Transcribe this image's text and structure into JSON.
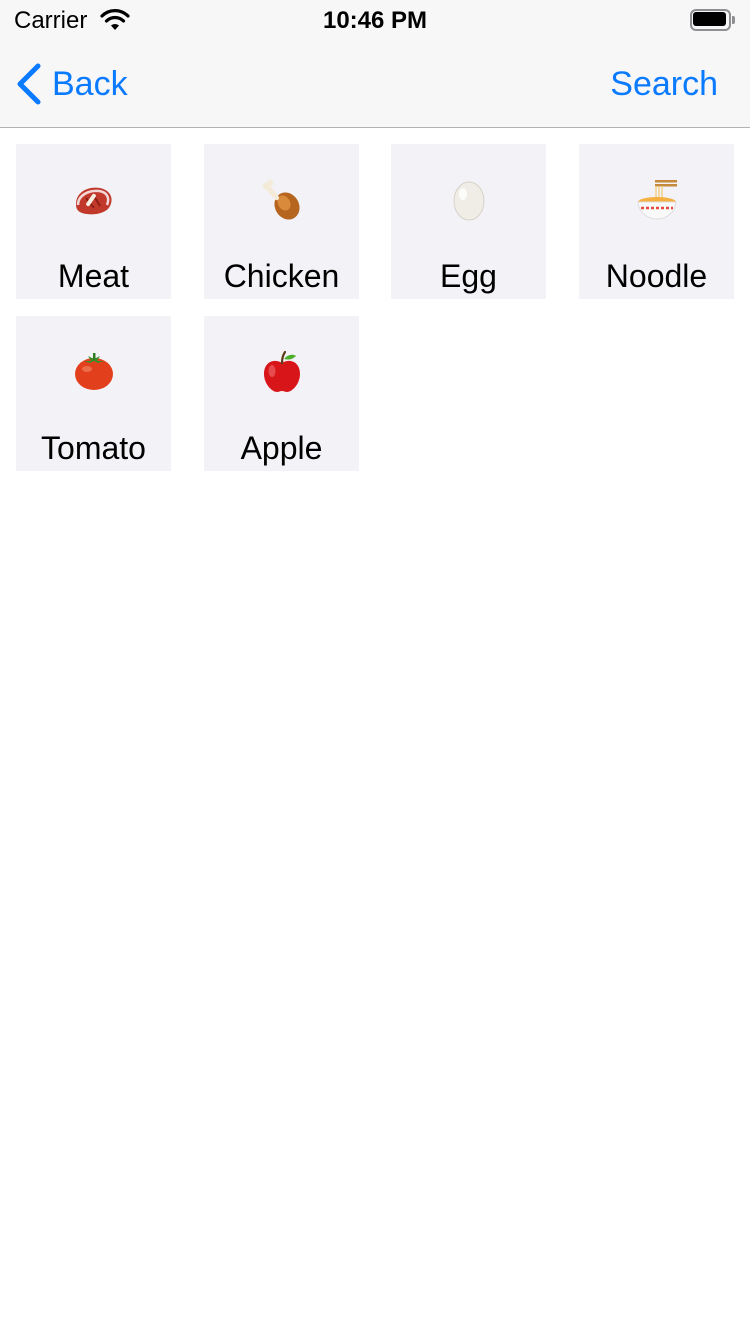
{
  "status_bar": {
    "carrier": "Carrier",
    "time": "10:46 PM"
  },
  "nav": {
    "back_label": "Back",
    "search_label": "Search"
  },
  "items": [
    {
      "label": "Meat",
      "icon": "meat-icon"
    },
    {
      "label": "Chicken",
      "icon": "chicken-leg-icon"
    },
    {
      "label": "Egg",
      "icon": "egg-icon"
    },
    {
      "label": "Noodle",
      "icon": "noodle-bowl-icon"
    },
    {
      "label": "Tomato",
      "icon": "tomato-icon"
    },
    {
      "label": "Apple",
      "icon": "apple-icon"
    }
  ],
  "colors": {
    "accent": "#0a7aff",
    "tile_background": "#f2f2f7",
    "bar_background": "#f7f7f7"
  }
}
